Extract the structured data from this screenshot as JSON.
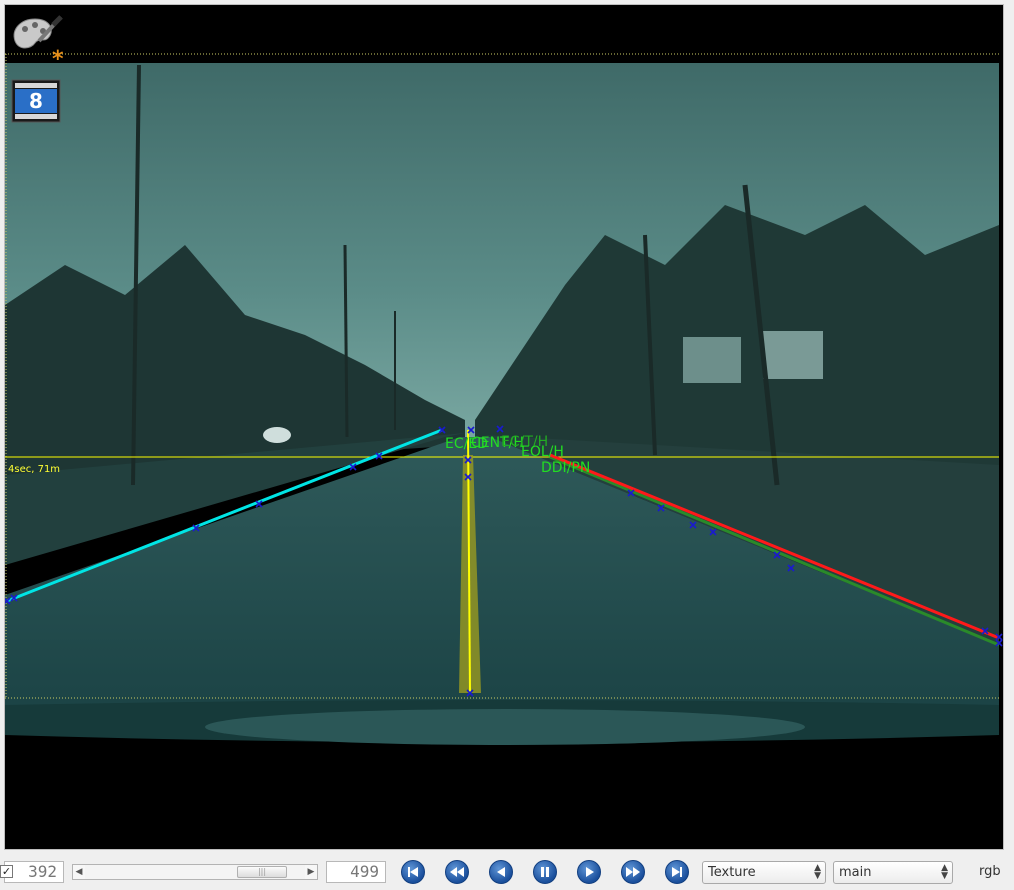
{
  "overlay": {
    "distance_label": "4sec, 71m",
    "lane_labels": [
      "EC/ED",
      "CENT/H",
      "EC/T/H",
      "EOL/H",
      "DDI/PN"
    ],
    "colors": {
      "left_lane": "#00e5e5",
      "right_lane": "#ff1a1a",
      "center_lane": "#ffff00",
      "label": "#22dd22",
      "horizon": "#ffff00"
    }
  },
  "icons": {
    "tools": "paint-palette-icon",
    "frame_badge": "film-clip-icon",
    "frame_badge_text": "8",
    "modified_marker": "*"
  },
  "toolbar": {
    "start_frame": "392",
    "end_frame": "499",
    "buttons": [
      "skip-to-start",
      "fast-backward",
      "step-back",
      "pause",
      "play",
      "fast-forward",
      "skip-to-end"
    ],
    "render_mode": "Texture",
    "view": "main",
    "rgb_label": "rgb",
    "rgb_checked": true
  }
}
